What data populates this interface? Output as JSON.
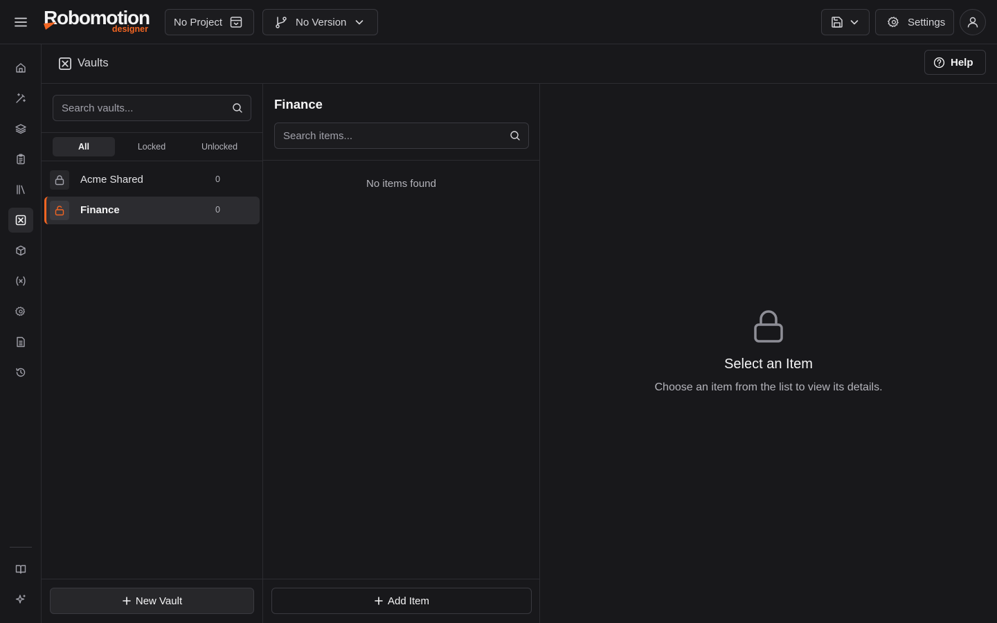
{
  "app": {
    "logo_main": "Robomotion",
    "logo_sub": "designer"
  },
  "topbar": {
    "project_label": "No Project",
    "version_label": "No Version",
    "settings_label": "Settings"
  },
  "sidebar": {
    "items": [
      {
        "name": "home-icon",
        "active": false
      },
      {
        "name": "magic-wand-icon",
        "active": false
      },
      {
        "name": "layers-icon",
        "active": false
      },
      {
        "name": "clipboard-icon",
        "active": false
      },
      {
        "name": "library-icon",
        "active": false
      },
      {
        "name": "vault-icon",
        "active": true
      },
      {
        "name": "package-icon",
        "active": false
      },
      {
        "name": "variable-icon",
        "active": false
      },
      {
        "name": "gear-icon",
        "active": false
      },
      {
        "name": "file-text-icon",
        "active": false
      },
      {
        "name": "history-icon",
        "active": false
      }
    ],
    "bottom_items": [
      {
        "name": "book-icon"
      },
      {
        "name": "sparkles-icon"
      }
    ]
  },
  "page": {
    "title": "Vaults",
    "help_label": "Help"
  },
  "vaults": {
    "search_placeholder": "Search vaults...",
    "filters": [
      {
        "label": "All",
        "active": true
      },
      {
        "label": "Locked",
        "active": false
      },
      {
        "label": "Unlocked",
        "active": false
      }
    ],
    "list": [
      {
        "name": "Acme Shared",
        "count": "0",
        "locked": true,
        "selected": false
      },
      {
        "name": "Finance",
        "count": "0",
        "locked": false,
        "selected": true
      }
    ],
    "new_vault_label": "New Vault"
  },
  "items": {
    "title": "Finance",
    "search_placeholder": "Search items...",
    "empty_text": "No items found",
    "add_item_label": "Add Item"
  },
  "detail": {
    "title": "Select an Item",
    "subtitle": "Choose an item from the list to view its details."
  },
  "colors": {
    "accent": "#f26522",
    "background": "#18181b",
    "border": "#2c2c31"
  }
}
